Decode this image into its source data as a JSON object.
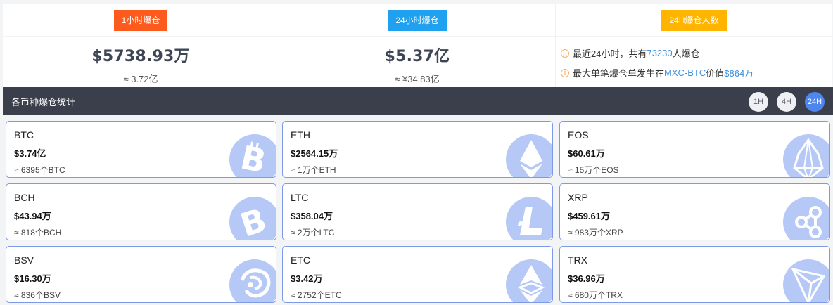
{
  "summary": {
    "hour": {
      "tag": "1小时爆仓",
      "tag_color": "#fd5a1e",
      "amount": "$5738.93万",
      "cny": "≈ 3.72亿"
    },
    "day": {
      "tag": "24小时爆仓",
      "tag_color": "#1fa1f0",
      "amount": "$5.37亿",
      "cny": "≈ ¥34.83亿"
    },
    "people": {
      "tag": "24H爆仓人数",
      "tag_color": "#ffb400",
      "line1_prefix": "最近24小时，共有",
      "line1_count": "73230",
      "line1_suffix": "人爆仓",
      "line2_prefix": "最大单笔爆仓单发生在",
      "line2_pair": "MXC-BTC",
      "line2_mid": "价值",
      "line2_value": "$864万"
    }
  },
  "stats": {
    "title": "各币种爆仓统计",
    "periods": [
      "1H",
      "4H",
      "24H"
    ],
    "active_period": "24H"
  },
  "coins": [
    {
      "symbol": "BTC",
      "amount": "$3.74亿",
      "qty": "≈ 6395个BTC",
      "icon": "bitcoin-icon"
    },
    {
      "symbol": "ETH",
      "amount": "$2564.15万",
      "qty": "≈ 1万个ETH",
      "icon": "ethereum-icon"
    },
    {
      "symbol": "EOS",
      "amount": "$60.61万",
      "qty": "≈ 15万个EOS",
      "icon": "eos-icon"
    },
    {
      "symbol": "BCH",
      "amount": "$43.94万",
      "qty": "≈ 818个BCH",
      "icon": "bitcoin-cash-icon"
    },
    {
      "symbol": "LTC",
      "amount": "$358.04万",
      "qty": "≈ 2万个LTC",
      "icon": "litecoin-icon"
    },
    {
      "symbol": "XRP",
      "amount": "$459.61万",
      "qty": "≈ 983万个XRP",
      "icon": "ripple-icon"
    },
    {
      "symbol": "BSV",
      "amount": "$16.30万",
      "qty": "≈ 836个BSV",
      "icon": "bitcoin-sv-icon"
    },
    {
      "symbol": "ETC",
      "amount": "$3.42万",
      "qty": "≈ 2752个ETC",
      "icon": "ethereum-classic-icon"
    },
    {
      "symbol": "TRX",
      "amount": "$36.96万",
      "qty": "≈ 680万个TRX",
      "icon": "tron-icon"
    }
  ],
  "colors": {
    "card_border": "#7e99e5",
    "coin_bg": "#b5c8f6",
    "active_period": "#4f85ef",
    "bar_bg": "#3b3f4b"
  }
}
